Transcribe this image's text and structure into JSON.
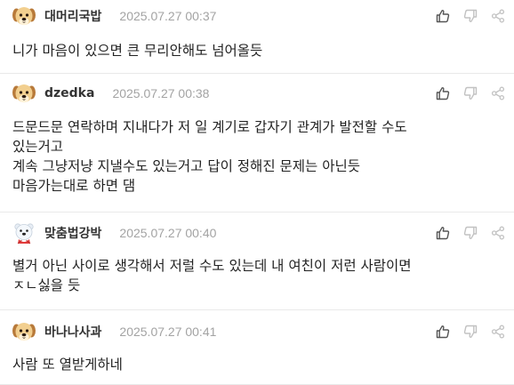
{
  "comments": [
    {
      "avatar": "puppy-avatar",
      "nickname": "대머리국밥",
      "time": "2025.07.27 00:37",
      "lines": [
        "니가 마음이 있으면 큰 무리안해도 넘어올듯"
      ]
    },
    {
      "avatar": "puppy-avatar",
      "nickname": "dzedka",
      "time": "2025.07.27 00:38",
      "lines": [
        "드문드문 연락하며 지내다가 저 일 계기로 갑자기 관계가 발전할 수도",
        "있는거고",
        "계속 그냥저냥 지낼수도 있는거고 답이 정해진 문제는 아닌듯",
        "마음가는대로 하면 댐"
      ]
    },
    {
      "avatar": "polar-bear-avatar",
      "nickname": "맞춤법강박",
      "time": "2025.07.27 00:40",
      "lines": [
        "별거 아닌 사이로 생각해서 저럴 수도 있는데 내 여친이 저런 사람이면",
        "ㅈㄴ싫을 듯"
      ]
    },
    {
      "avatar": "puppy-avatar",
      "nickname": "바나나사과",
      "time": "2025.07.27 00:41",
      "lines": [
        "사람 또 열받게하네"
      ]
    }
  ],
  "action_icons": [
    "thumbs-up-icon",
    "thumbs-down-icon",
    "share-icon"
  ],
  "colors": {
    "text": "#222222",
    "time": "#a3a3a3",
    "icon": "#555555",
    "divider": "#e9e9e9"
  }
}
